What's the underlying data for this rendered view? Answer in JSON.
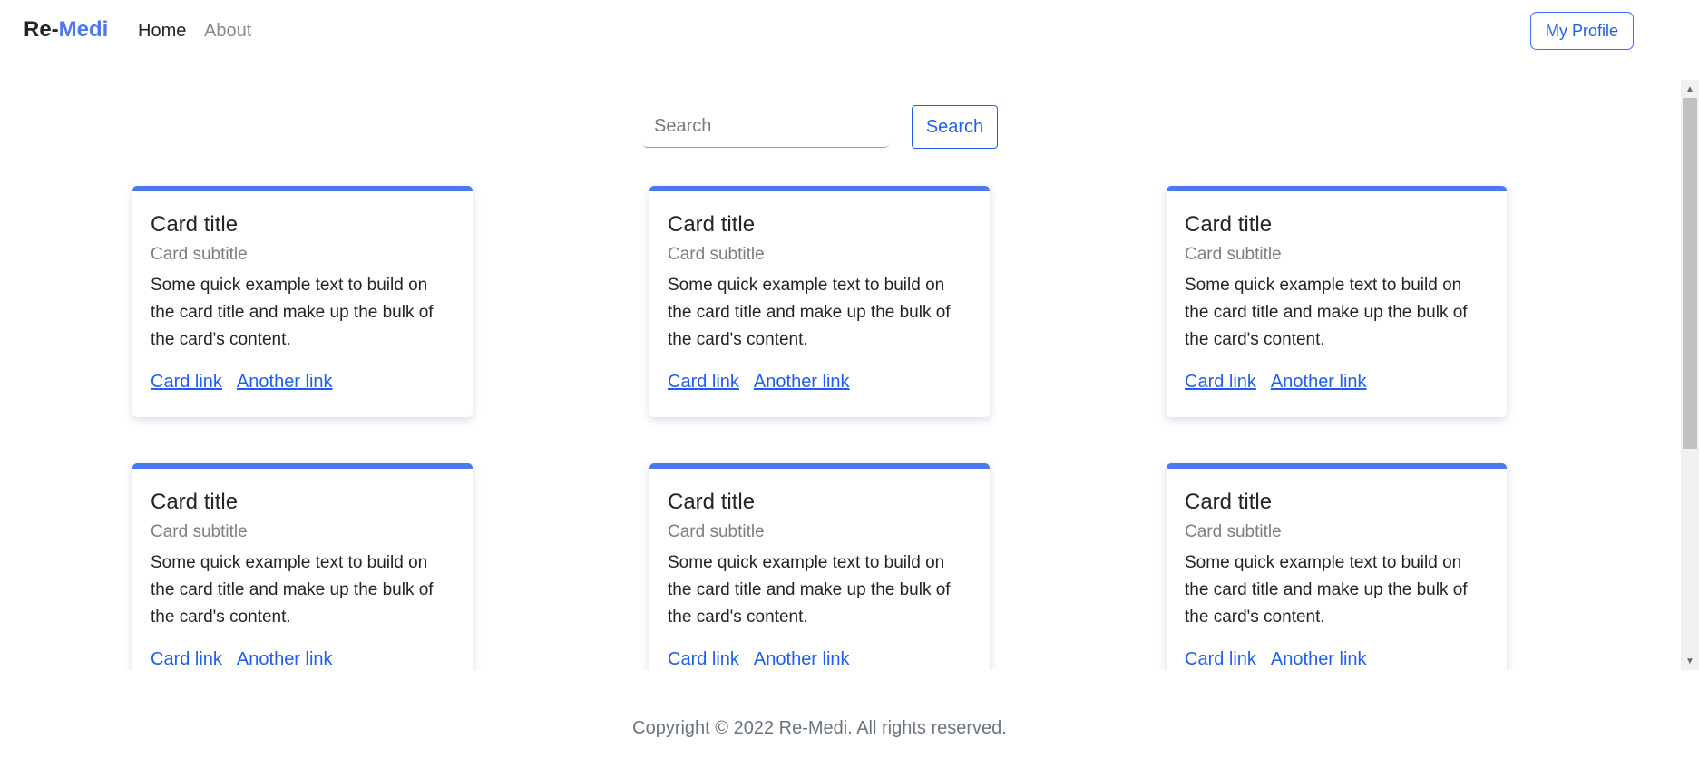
{
  "brand": {
    "prefix": "Re-",
    "accent": "Medi"
  },
  "nav": {
    "home": "Home",
    "about": "About",
    "profile_button": "My Profile"
  },
  "search": {
    "placeholder": "Search",
    "value": "",
    "button": "Search"
  },
  "cards": [
    {
      "title": "Card title",
      "subtitle": "Card subtitle",
      "text": "Some quick example text to build on the card title and make up the bulk of the card's content.",
      "link1": "Card link",
      "link2": "Another link"
    },
    {
      "title": "Card title",
      "subtitle": "Card subtitle",
      "text": "Some quick example text to build on the card title and make up the bulk of the card's content.",
      "link1": "Card link",
      "link2": "Another link"
    },
    {
      "title": "Card title",
      "subtitle": "Card subtitle",
      "text": "Some quick example text to build on the card title and make up the bulk of the card's content.",
      "link1": "Card link",
      "link2": "Another link"
    },
    {
      "title": "Card title",
      "subtitle": "Card subtitle",
      "text": "Some quick example text to build on the card title and make up the bulk of the card's content.",
      "link1": "Card link",
      "link2": "Another link"
    },
    {
      "title": "Card title",
      "subtitle": "Card subtitle",
      "text": "Some quick example text to build on the card title and make up the bulk of the card's content.",
      "link1": "Card link",
      "link2": "Another link"
    },
    {
      "title": "Card title",
      "subtitle": "Card subtitle",
      "text": "Some quick example text to build on the card title and make up the bulk of the card's content.",
      "link1": "Card link",
      "link2": "Another link"
    }
  ],
  "footer": {
    "text": "Copyright © 2022 Re-Medi. All rights reserved."
  },
  "colors": {
    "accent": "#4d79f0",
    "link": "#1f5ef0",
    "muted": "#6c757d"
  },
  "icons": {
    "scroll_up": "scroll-up-arrow-icon",
    "scroll_down": "scroll-down-arrow-icon"
  }
}
